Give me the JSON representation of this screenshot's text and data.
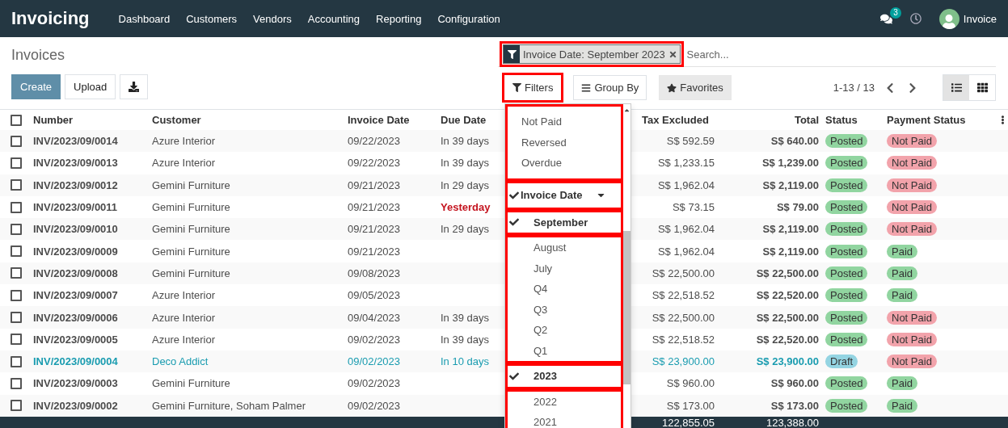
{
  "navbar": {
    "brand": "Invoicing",
    "menu": [
      "Dashboard",
      "Customers",
      "Vendors",
      "Accounting",
      "Reporting",
      "Configuration"
    ],
    "messages_count": "3",
    "user": "Invoice"
  },
  "title": "Invoices",
  "buttons": {
    "create": "Create",
    "upload": "Upload"
  },
  "search": {
    "facet": {
      "label": "Invoice Date: September 2023",
      "highlighted": true
    },
    "placeholder": "Search..."
  },
  "search_options": [
    {
      "kind": "filters",
      "label": "Filters",
      "highlighted": true
    },
    {
      "kind": "groupby",
      "label": "Group By",
      "highlighted": false
    },
    {
      "kind": "favorites",
      "label": "Favorites",
      "highlighted": false
    }
  ],
  "pager": "1-13 / 13",
  "views": [
    {
      "kind": "list",
      "selected": true
    },
    {
      "kind": "kanban",
      "selected": false
    }
  ],
  "filters_menu": {
    "sections": [
      {
        "highlighted": true,
        "items": [
          {
            "kind": "option",
            "label": "Not Paid",
            "checked": false
          },
          {
            "kind": "option",
            "label": "Reversed",
            "checked": false
          },
          {
            "kind": "option",
            "label": "Overdue",
            "checked": false
          }
        ]
      },
      {
        "highlighted": true,
        "items": [
          {
            "kind": "group",
            "label": "Invoice Date",
            "checked": true,
            "expanded": true
          }
        ]
      },
      {
        "highlighted": true,
        "items": [
          {
            "kind": "sub",
            "label": "September",
            "checked": true
          }
        ]
      },
      {
        "highlighted": true,
        "items": [
          {
            "kind": "sub",
            "label": "August",
            "checked": false
          },
          {
            "kind": "sub",
            "label": "July",
            "checked": false
          },
          {
            "kind": "sub",
            "label": "Q4",
            "checked": false
          },
          {
            "kind": "sub",
            "label": "Q3",
            "checked": false
          },
          {
            "kind": "sub",
            "label": "Q2",
            "checked": false
          },
          {
            "kind": "sub",
            "label": "Q1",
            "checked": false
          }
        ]
      },
      {
        "highlighted": true,
        "items": [
          {
            "kind": "sub",
            "label": "2023",
            "checked": true
          }
        ]
      },
      {
        "highlighted": true,
        "items": [
          {
            "kind": "sub",
            "label": "2022",
            "checked": false
          },
          {
            "kind": "sub",
            "label": "2021",
            "checked": false
          }
        ]
      }
    ]
  },
  "table": {
    "columns": [
      "Number",
      "Customer",
      "Invoice Date",
      "Due Date",
      "Tax Excluded",
      "Total",
      "Status",
      "Payment Status"
    ],
    "all_checked": false,
    "rows": [
      {
        "number": "INV/2023/09/0014",
        "customer": "Azure Interior",
        "invoice_date": "09/22/2023",
        "due_date": "In 39 days",
        "overdue": false,
        "draft": false,
        "selected": false,
        "tax_excluded": "S$ 592.59",
        "total": "S$ 640.00",
        "status": {
          "label": "Posted",
          "color": "#91d5a0"
        },
        "payment": {
          "label": "Not Paid",
          "color": "#f2a3ab"
        }
      },
      {
        "number": "INV/2023/09/0013",
        "customer": "Azure Interior",
        "invoice_date": "09/22/2023",
        "due_date": "In 39 days",
        "overdue": false,
        "draft": false,
        "selected": false,
        "tax_excluded": "S$ 1,233.15",
        "total": "S$ 1,239.00",
        "status": {
          "label": "Posted",
          "color": "#91d5a0"
        },
        "payment": {
          "label": "Not Paid",
          "color": "#f2a3ab"
        }
      },
      {
        "number": "INV/2023/09/0012",
        "customer": "Gemini Furniture",
        "invoice_date": "09/21/2023",
        "due_date": "In 29 days",
        "overdue": false,
        "draft": false,
        "selected": false,
        "tax_excluded": "S$ 1,962.04",
        "total": "S$ 2,119.00",
        "status": {
          "label": "Posted",
          "color": "#91d5a0"
        },
        "payment": {
          "label": "Not Paid",
          "color": "#f2a3ab"
        }
      },
      {
        "number": "INV/2023/09/0011",
        "customer": "Gemini Furniture",
        "invoice_date": "09/21/2023",
        "due_date": "Yesterday",
        "overdue": true,
        "draft": false,
        "selected": false,
        "tax_excluded": "S$ 73.15",
        "total": "S$ 79.00",
        "status": {
          "label": "Posted",
          "color": "#91d5a0"
        },
        "payment": {
          "label": "Not Paid",
          "color": "#f2a3ab"
        }
      },
      {
        "number": "INV/2023/09/0010",
        "customer": "Gemini Furniture",
        "invoice_date": "09/21/2023",
        "due_date": "In 29 days",
        "overdue": false,
        "draft": false,
        "selected": false,
        "tax_excluded": "S$ 1,962.04",
        "total": "S$ 2,119.00",
        "status": {
          "label": "Posted",
          "color": "#91d5a0"
        },
        "payment": {
          "label": "Not Paid",
          "color": "#f2a3ab"
        }
      },
      {
        "number": "INV/2023/09/0009",
        "customer": "Gemini Furniture",
        "invoice_date": "09/21/2023",
        "draft": false,
        "selected": false,
        "tax_excluded": "S$ 1,962.04",
        "total": "S$ 2,119.00",
        "status": {
          "label": "Posted",
          "color": "#91d5a0"
        },
        "payment": {
          "label": "Paid",
          "color": "#91d5a0"
        }
      },
      {
        "number": "INV/2023/09/0008",
        "customer": "Gemini Furniture",
        "invoice_date": "09/08/2023",
        "draft": false,
        "selected": false,
        "tax_excluded": "S$ 22,500.00",
        "total": "S$ 22,500.00",
        "status": {
          "label": "Posted",
          "color": "#91d5a0"
        },
        "payment": {
          "label": "Paid",
          "color": "#91d5a0"
        }
      },
      {
        "number": "INV/2023/09/0007",
        "customer": "Azure Interior",
        "invoice_date": "09/05/2023",
        "draft": false,
        "selected": false,
        "tax_excluded": "S$ 22,518.52",
        "total": "S$ 22,520.00",
        "status": {
          "label": "Posted",
          "color": "#91d5a0"
        },
        "payment": {
          "label": "Paid",
          "color": "#91d5a0"
        }
      },
      {
        "number": "INV/2023/09/0006",
        "customer": "Azure Interior",
        "invoice_date": "09/04/2023",
        "due_date": "In 39 days",
        "overdue": false,
        "draft": false,
        "selected": false,
        "tax_excluded": "S$ 22,500.00",
        "total": "S$ 22,500.00",
        "status": {
          "label": "Posted",
          "color": "#91d5a0"
        },
        "payment": {
          "label": "Not Paid",
          "color": "#f2a3ab"
        }
      },
      {
        "number": "INV/2023/09/0005",
        "customer": "Azure Interior",
        "invoice_date": "09/02/2023",
        "due_date": "In 39 days",
        "overdue": false,
        "draft": false,
        "selected": false,
        "tax_excluded": "S$ 22,518.52",
        "total": "S$ 22,520.00",
        "status": {
          "label": "Posted",
          "color": "#91d5a0"
        },
        "payment": {
          "label": "Not Paid",
          "color": "#f2a3ab"
        }
      },
      {
        "number": "INV/2023/09/0004",
        "customer": "Deco Addict",
        "invoice_date": "09/02/2023",
        "due_date": "In 10 days",
        "overdue": false,
        "draft": true,
        "selected": false,
        "tax_excluded": "S$ 23,900.00",
        "total": "S$ 23,900.00",
        "status": {
          "label": "Draft",
          "color": "#94d4e2"
        },
        "payment": {
          "label": "Not Paid",
          "color": "#f2a3ab"
        }
      },
      {
        "number": "INV/2023/09/0003",
        "customer": "Gemini Furniture",
        "invoice_date": "09/02/2023",
        "draft": false,
        "selected": false,
        "tax_excluded": "S$ 960.00",
        "total": "S$ 960.00",
        "status": {
          "label": "Posted",
          "color": "#91d5a0"
        },
        "payment": {
          "label": "Paid",
          "color": "#91d5a0"
        }
      },
      {
        "number": "INV/2023/09/0002",
        "customer": "Gemini Furniture, Soham Palmer",
        "invoice_date": "09/02/2023",
        "draft": false,
        "selected": false,
        "tax_excluded": "S$ 173.00",
        "total": "S$ 173.00",
        "status": {
          "label": "Posted",
          "color": "#91d5a0"
        },
        "payment": {
          "label": "Paid",
          "color": "#91d5a0"
        }
      }
    ],
    "totals": {
      "tax_excluded": "122,855.05",
      "total": "123,388.00"
    }
  }
}
